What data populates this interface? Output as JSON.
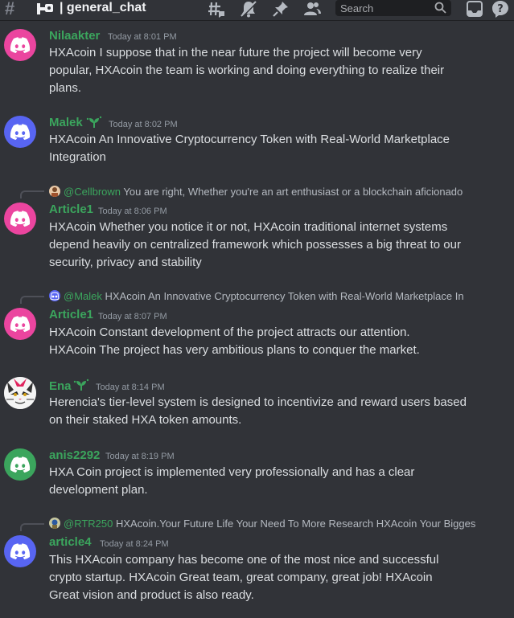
{
  "header": {
    "channel": "| general_chat",
    "search_placeholder": "Search"
  },
  "colors": {
    "background": "#313338",
    "username_green": "#3ba55d",
    "discord_blue": "#5865f2",
    "discord_pink": "#eb459f"
  },
  "messages": [
    {
      "author": "Nilaakter",
      "time": "Today at 8:01 PM",
      "avatar": "discord-pink",
      "lines": [
        "HXAcoin  I suppose that in the near future the project will become very",
        "popular, HXAcoin  the team is working and doing everything to realize their",
        "plans."
      ]
    },
    {
      "author": "Malek",
      "time": "Today at 8:02 PM",
      "avatar": "discord-blue",
      "lines": [
        "HXAcoin An Innovative Cryptocurrency Token with Real-World Marketplace",
        "Integration"
      ]
    },
    {
      "author": "Article1",
      "time": "Today at 8:06 PM",
      "avatar": "discord-pink",
      "reply_to": "@Cellbrown",
      "reply_text": "You are right, Whether you're an art enthusiast or a blockchain aficionado",
      "lines": [
        "HXAcoin  Whether you notice it or not, HXAcoin  traditional internet systems",
        "depend heavily on centralized framework which possesses a big threat to our",
        "security, privacy and stability"
      ]
    },
    {
      "author": "Article1",
      "time": "Today at 8:07 PM",
      "avatar": "discord-pink",
      "reply_to": "@Malek",
      "reply_text": "HXAcoin An Innovative Cryptocurrency Token with Real-World Marketplace In",
      "lines": [
        "HXAcoin  Constant development of the project attracts our attention.",
        "HXAcoin  The project has very ambitious plans to conquer the market."
      ]
    },
    {
      "author": "Ena",
      "time": "Today at 8:14 PM",
      "avatar": "cat-face",
      "lines": [
        "Herencia's tier-level system is designed to incentivize and reward users based",
        "on their staked HXA token amounts."
      ]
    },
    {
      "author": "anis2292",
      "time": "Today at 8:19 PM",
      "avatar": "discord-green",
      "lines": [
        "HXA Coin project is implemented very professionally and has a clear",
        "development plan."
      ]
    },
    {
      "author": "article4",
      "time": "Today at 8:24 PM",
      "avatar": "discord-blue",
      "reply_to": "@RTR250",
      "reply_text": "HXAcoin.Your Future Life Your Need To More Research HXAcoin Your Bigges",
      "lines": [
        "This HXAcoin  company has become one of the most nice and successful",
        "crypto startup. HXAcoin  Great team, great company, great job! HXAcoin",
        "Great vision and product is also ready."
      ]
    }
  ]
}
